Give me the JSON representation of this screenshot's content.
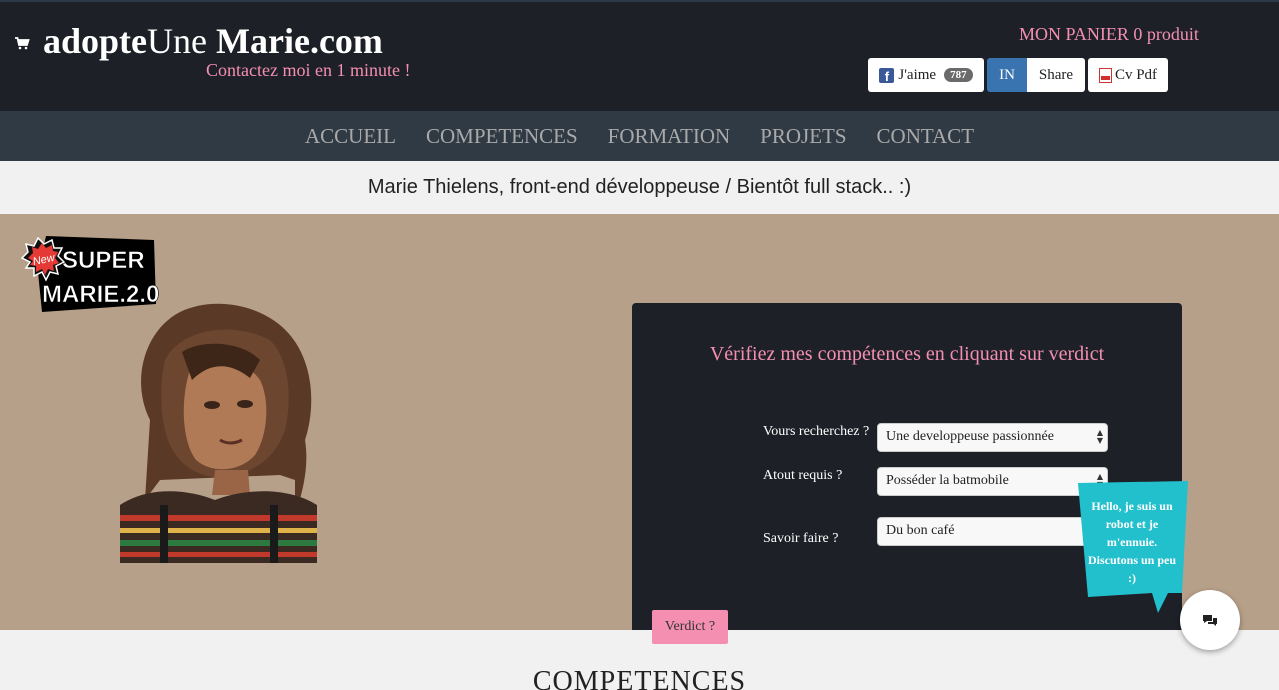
{
  "header": {
    "logo": {
      "part1": "adopte",
      "part2": "Une ",
      "part3": "Marie.com"
    },
    "tagline": "Contactez moi en 1 minute !",
    "cart": "MON PANIER 0 produit",
    "facebook": {
      "label": "J'aime",
      "count": "787"
    },
    "linkedin": {
      "label": "IN",
      "share": "Share"
    },
    "cv_label": "Cv Pdf"
  },
  "nav": {
    "items": [
      "ACCUEIL",
      "COMPETENCES",
      "FORMATION",
      "PROJETS",
      "CONTACT"
    ]
  },
  "subtitle": "Marie Thielens, front-end développeuse / Bientôt full stack.. :)",
  "hero": {
    "badge": {
      "new": "New",
      "line1": "SUPER",
      "line2": "MARIE.2.0"
    },
    "panel": {
      "title": "Vérifiez mes compétences en cliquant sur verdict",
      "fields": [
        {
          "label": "Vours recherchez ?",
          "value": "Une developpeuse passionnée"
        },
        {
          "label": "Atout requis ?",
          "value": "Posséder la batmobile"
        },
        {
          "label": "Savoir faire ?",
          "value": "Du bon café"
        }
      ]
    },
    "verdict_label": "Verdict ?",
    "bubble_text": "Hello, je suis un robot et je m'ennuie. Discutons un peu :)"
  },
  "section_title": "COMPETENCES",
  "colors": {
    "header_bg": "#1d2127",
    "nav_bg": "#2f3a44",
    "accent_pink": "#f48fb1",
    "hero_bg": "#b7a089",
    "bubble": "#22bfcc"
  },
  "icons": [
    "cart-icon",
    "facebook-icon",
    "pdf-icon",
    "chat-icon"
  ]
}
